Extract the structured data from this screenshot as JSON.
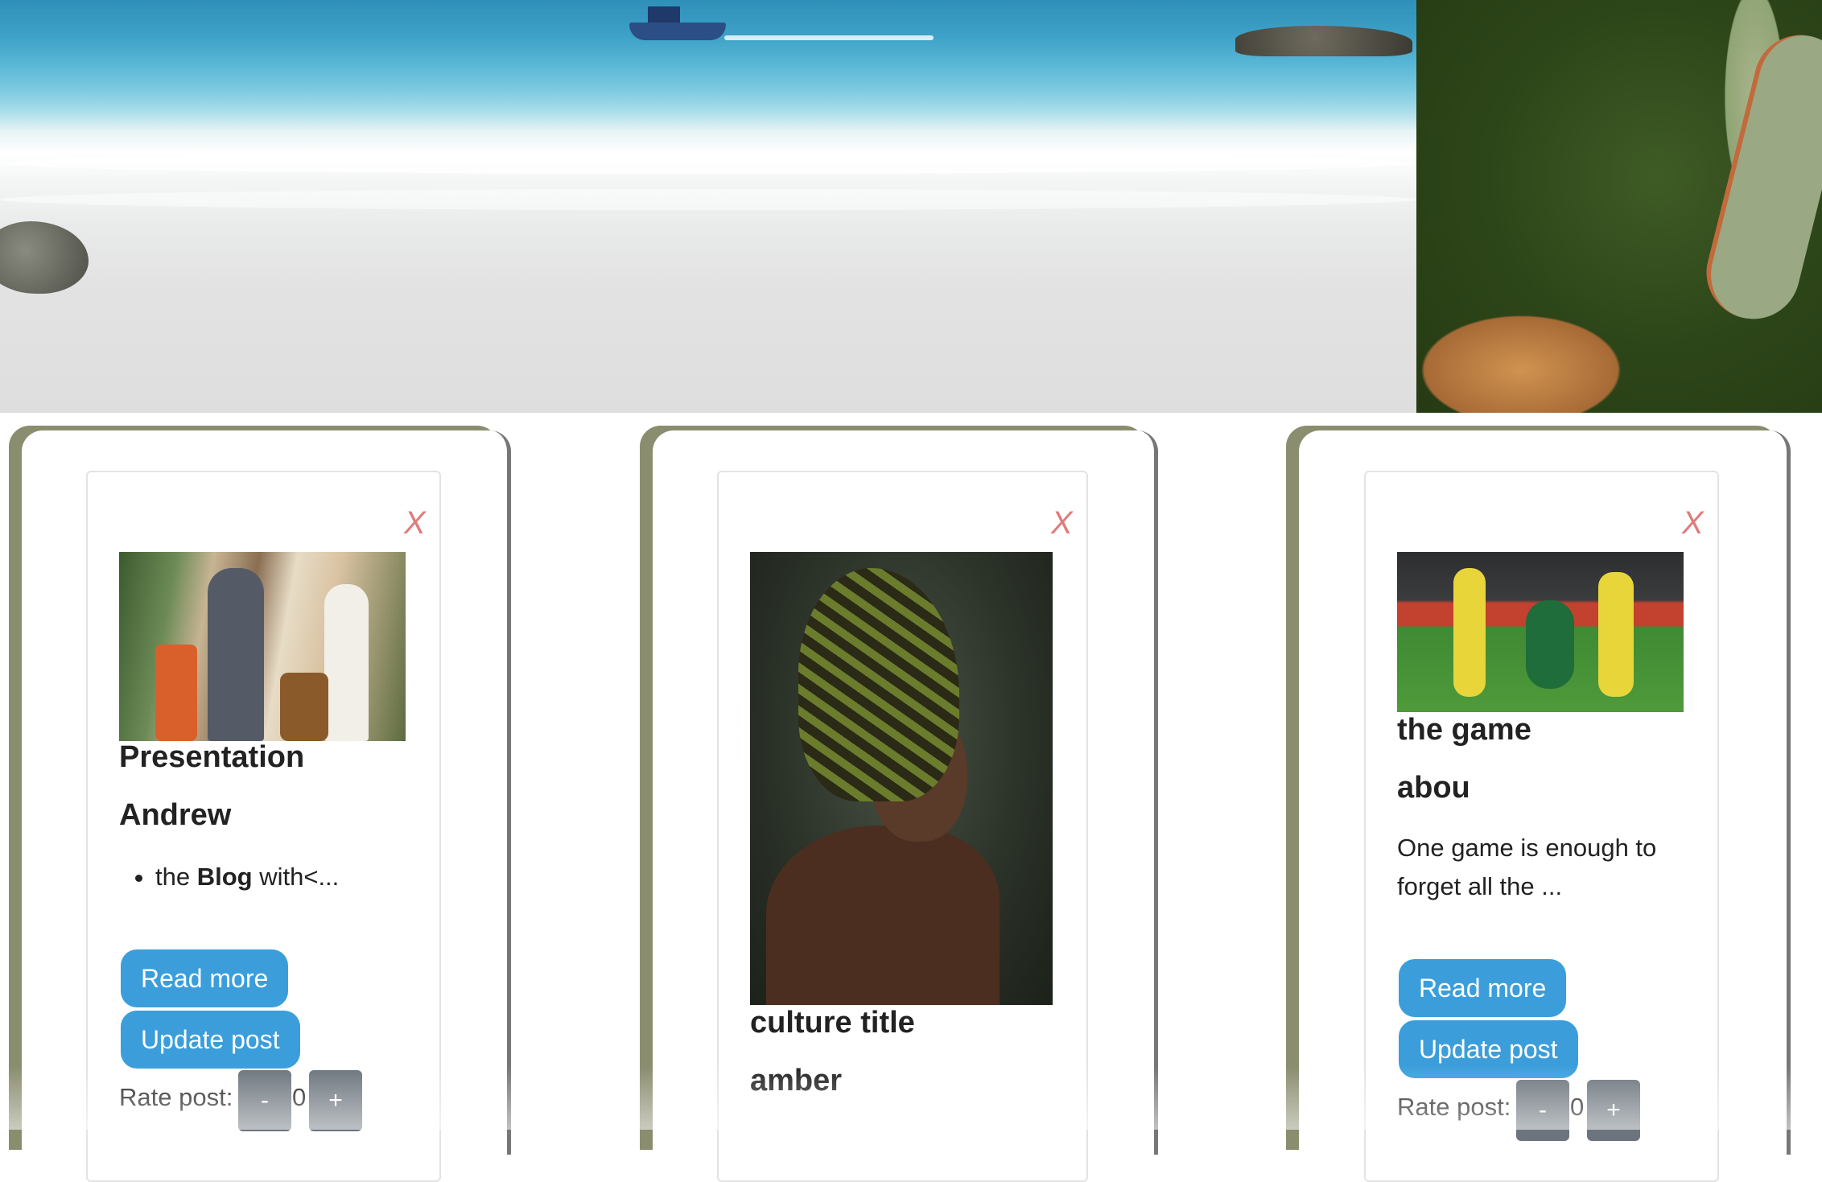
{
  "hero": {
    "images": [
      "beach-scene",
      "canyon-scene"
    ]
  },
  "cards": [
    {
      "close": "X",
      "image": "drumming-people-photo",
      "title": "Presentation",
      "author": "Andrew",
      "excerpt": {
        "prefix": "the ",
        "bold": "Blog",
        "suffix": " with<..."
      },
      "read_more": "Read more",
      "update_post": "Update post",
      "rate_label": "Rate post:",
      "minus": "-",
      "rating": "0",
      "plus": "+"
    },
    {
      "close": "X",
      "image": "woman-headwrap-photo",
      "title": "culture title",
      "author": "amber"
    },
    {
      "close": "X",
      "image": "football-match-photo",
      "title": "the game",
      "author": "abou",
      "excerpt": "One game is enough to forget all the ...",
      "read_more": "Read more",
      "update_post": "Update post",
      "rate_label": "Rate post:",
      "minus": "-",
      "rating": "0",
      "plus": "+"
    }
  ],
  "colors": {
    "button": "#3b9edb",
    "rate_button": "#6c757d",
    "close": "#e07b7b",
    "shadow": "#8b8d6f"
  }
}
